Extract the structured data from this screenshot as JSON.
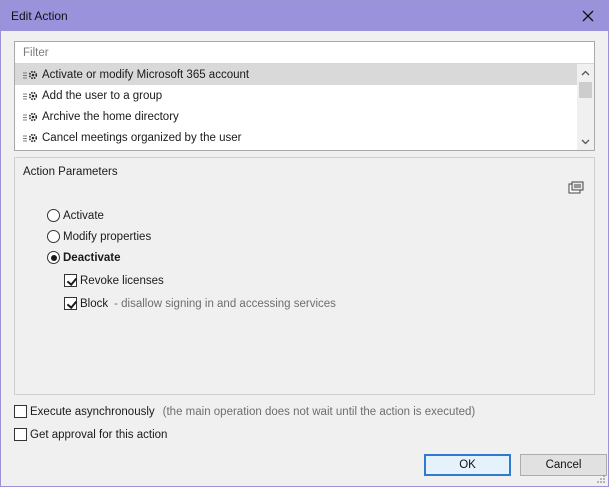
{
  "window": {
    "title": "Edit Action"
  },
  "filter": {
    "placeholder": "Filter"
  },
  "actions": {
    "items": [
      {
        "label": "Activate or modify Microsoft 365 account",
        "selected": true
      },
      {
        "label": "Add the user to a group",
        "selected": false
      },
      {
        "label": "Archive the home directory",
        "selected": false
      },
      {
        "label": "Cancel meetings organized by the user",
        "selected": false
      }
    ]
  },
  "params": {
    "title": "Action Parameters",
    "radios": {
      "activate": "Activate",
      "modify": "Modify properties",
      "deactivate": "Deactivate",
      "selected": "deactivate"
    },
    "revoke": {
      "label": "Revoke licenses",
      "checked": true
    },
    "block": {
      "label": "Block",
      "hint": "- disallow signing in and accessing services",
      "checked": true
    }
  },
  "options": {
    "async": {
      "label": "Execute asynchronously",
      "hint": "(the main operation does not wait until the action is executed)",
      "checked": false
    },
    "approval": {
      "label": "Get approval for this action",
      "checked": false
    }
  },
  "buttons": {
    "ok": "OK",
    "cancel": "Cancel"
  },
  "colors": {
    "titlebar": "#9a93dc",
    "selection": "#d9d9d9",
    "accent": "#2f7bd0"
  }
}
